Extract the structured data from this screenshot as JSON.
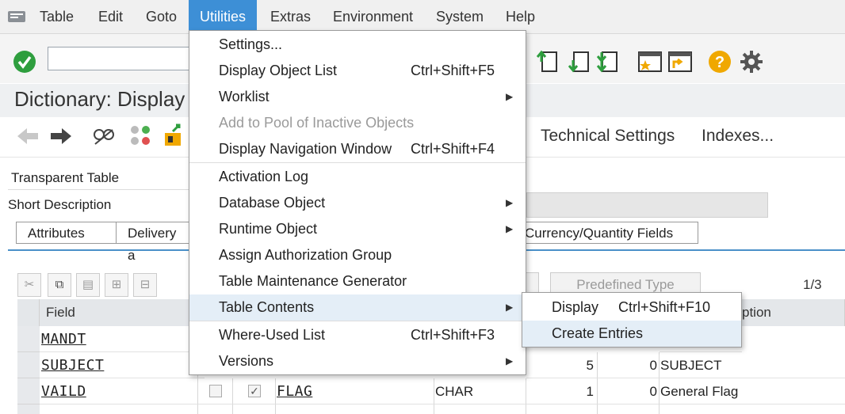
{
  "menubar": {
    "items": [
      {
        "label": "Table"
      },
      {
        "label": "Edit"
      },
      {
        "label": "Goto"
      },
      {
        "label": "Utilities"
      },
      {
        "label": "Extras"
      },
      {
        "label": "Environment"
      },
      {
        "label": "System"
      },
      {
        "label": "Help"
      }
    ]
  },
  "toolbar": {
    "command_value": ""
  },
  "title": "Dictionary: Display",
  "appbar": {
    "technical_settings": "Technical Settings",
    "indexes": "Indexes..."
  },
  "header": {
    "type_label": "Transparent Table",
    "short_desc_label": "Short Description"
  },
  "tabs": [
    {
      "label": "Attributes"
    },
    {
      "label": "Delivery a"
    },
    {
      "label": "Currency/Quantity Fields"
    }
  ],
  "table_toolbar": {
    "predefined_type": "Predefined Type",
    "page": "1/3"
  },
  "grid": {
    "headers": {
      "field": "Field",
      "description": "ption"
    },
    "rows": [
      {
        "field": "MANDT",
        "key": true,
        "init": false,
        "data_element": "",
        "type": "",
        "length": "",
        "decimals": "",
        "desc": ""
      },
      {
        "field": "SUBJECT",
        "key": false,
        "init": false,
        "data_element": "",
        "type": "",
        "length": "5",
        "decimals": "0",
        "desc": "SUBJECT"
      },
      {
        "field": "VAILD",
        "key": false,
        "init": true,
        "data_element": "FLAG",
        "type": "CHAR",
        "length": "1",
        "decimals": "0",
        "desc": "General Flag"
      }
    ]
  },
  "utilities_menu": {
    "items": [
      {
        "label": "Settings...",
        "shortcut": ""
      },
      {
        "label": "Display Object List",
        "shortcut": "Ctrl+Shift+F5"
      },
      {
        "label": "Worklist",
        "shortcut": ""
      },
      {
        "label": "Add to Pool of Inactive Objects",
        "shortcut": ""
      },
      {
        "label": "Display Navigation Window",
        "shortcut": "Ctrl+Shift+F4"
      },
      {
        "label": "Activation Log",
        "shortcut": ""
      },
      {
        "label": "Database Object",
        "shortcut": ""
      },
      {
        "label": "Runtime Object",
        "shortcut": ""
      },
      {
        "label": "Assign Authorization Group",
        "shortcut": ""
      },
      {
        "label": "Table Maintenance Generator",
        "shortcut": ""
      },
      {
        "label": "Table Contents",
        "shortcut": ""
      },
      {
        "label": "Where-Used List",
        "shortcut": "Ctrl+Shift+F3"
      },
      {
        "label": "Versions",
        "shortcut": ""
      }
    ]
  },
  "table_contents_submenu": {
    "items": [
      {
        "label": "Display",
        "shortcut": "Ctrl+Shift+F10"
      },
      {
        "label": "Create Entries",
        "shortcut": ""
      }
    ]
  },
  "colors": {
    "accent": "#3d8fd6",
    "highlight": "#e4eef7",
    "ok_green": "#2e9e3e",
    "help_orange": "#f0a800"
  }
}
